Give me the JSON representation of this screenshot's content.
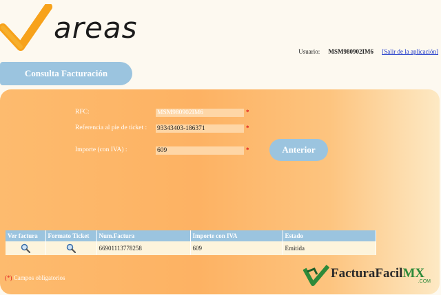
{
  "brand": {
    "logo_text": "areas",
    "accent": "#f7a21b"
  },
  "header": {
    "user_label": "Usuario:",
    "user_value": "MSM980902IM6",
    "logout_link": "[Salir de la aplicación]"
  },
  "title": "Consulta Facturación",
  "form": {
    "rfc": {
      "label": "RFC:",
      "value": "MSM980902IM6"
    },
    "ticket_ref": {
      "label": "Referencia al pie de ticket :",
      "value": "93343403-186371"
    },
    "importe": {
      "label": "Importe (con IVA) :",
      "value": "609"
    },
    "required_mark": "*",
    "back_button": "Anterior"
  },
  "table": {
    "headers": [
      "Ver factura",
      "Formato Ticket",
      "Num.Factura",
      "Importe con IVA",
      "Estado"
    ],
    "rows": [
      {
        "ver_icon": "magnifier-icon",
        "ticket_icon": "magnifier-icon",
        "num_factura": "66901113778258",
        "importe": "609",
        "estado": "Emitida"
      }
    ]
  },
  "required_note": {
    "mark": "(*)",
    "text": "Campos obligatorios"
  },
  "footer_logo": {
    "text": "FacturaFacil",
    "mx": "MX",
    "com": ".COM"
  },
  "colors": {
    "panel": "#fdb263",
    "tab_blue": "#9bc4df",
    "required_red": "#e02020",
    "link_blue": "#1a35c9"
  }
}
